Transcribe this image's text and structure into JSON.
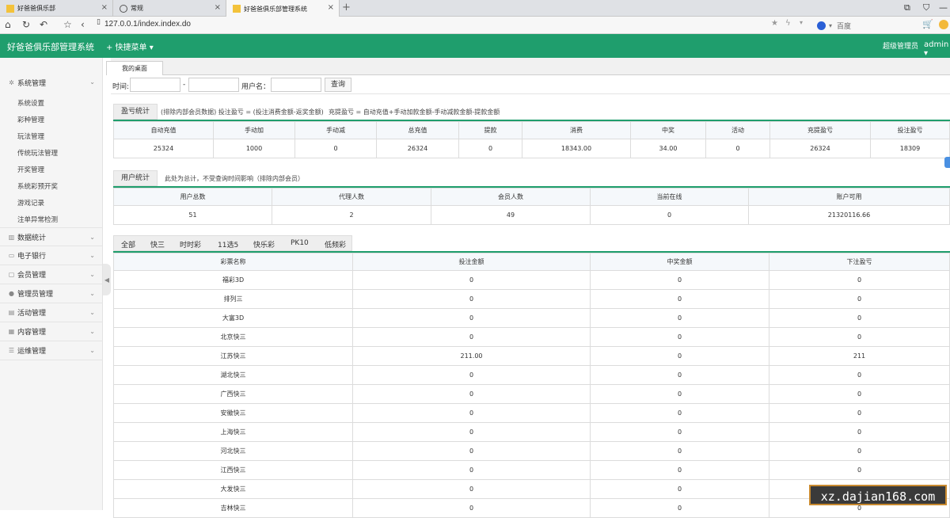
{
  "browser": {
    "tabs": [
      {
        "title": "好爸爸俱乐部"
      },
      {
        "title": "常规"
      },
      {
        "title": "好爸爸俱乐部管理系统"
      }
    ],
    "url": "127.0.0.1/index.index.do",
    "search_placeholder": "百度"
  },
  "header": {
    "title": "好爸爸俱乐部管理系统",
    "quick_menu": "+ 快捷菜单",
    "role": "超级管理员",
    "user": "admin"
  },
  "sidebar": {
    "groups": [
      {
        "label": "系统管理",
        "items": [
          "系统设置",
          "彩种管理",
          "玩法管理",
          "传统玩法管理",
          "开奖管理",
          "系统彩预开奖",
          "游戏记录",
          "注单异常检测"
        ]
      },
      {
        "label": "数据统计"
      },
      {
        "label": "电子银行"
      },
      {
        "label": "会员管理"
      },
      {
        "label": "管理员管理"
      },
      {
        "label": "活动管理"
      },
      {
        "label": "内容管理"
      },
      {
        "label": "运维管理"
      }
    ]
  },
  "page_tab": "我的桌面",
  "filter": {
    "time_label": "时间:",
    "dash": "-",
    "username_label": "用户名：",
    "query": "查询"
  },
  "profit": {
    "button": "盈亏统计",
    "note1": "(排除内部会员数据)  投注盈亏 = (投注消费金额-返奖金额)",
    "note2": "充提盈亏 = 自动充值+手动加款金额-手动减款金额-提款金额",
    "headers": [
      "自动充值",
      "手动加",
      "手动减",
      "总充值",
      "提款",
      "消费",
      "中奖",
      "活动",
      "充提盈亏",
      "投注盈亏"
    ],
    "values": [
      "25324",
      "1000",
      "0",
      "26324",
      "0",
      "18343.00",
      "34.00",
      "0",
      "26324",
      "18309"
    ]
  },
  "users": {
    "button": "用户统计",
    "note": "此处为总计，不受查询时间影响（排除内部会员）",
    "headers": [
      "用户总数",
      "代理人数",
      "会员人数",
      "当前在线",
      "账户可用"
    ],
    "values": [
      "51",
      "2",
      "49",
      "0",
      "21320116.66"
    ]
  },
  "lottery_tabs": [
    "全部",
    "快三",
    "时时彩",
    "11选5",
    "快乐彩",
    "PK10",
    "低频彩"
  ],
  "lottery_table": {
    "headers": [
      "彩票名称",
      "投注金额",
      "中奖金额",
      "下注盈亏"
    ],
    "rows": [
      [
        "福彩3D",
        "0",
        "0",
        "0"
      ],
      [
        "排列三",
        "0",
        "0",
        "0"
      ],
      [
        "大富3D",
        "0",
        "0",
        "0"
      ],
      [
        "北京快三",
        "0",
        "0",
        "0"
      ],
      [
        "江苏快三",
        "211.00",
        "0",
        "211"
      ],
      [
        "湖北快三",
        "0",
        "0",
        "0"
      ],
      [
        "广西快三",
        "0",
        "0",
        "0"
      ],
      [
        "安徽快三",
        "0",
        "0",
        "0"
      ],
      [
        "上海快三",
        "0",
        "0",
        "0"
      ],
      [
        "河北快三",
        "0",
        "0",
        "0"
      ],
      [
        "江西快三",
        "0",
        "0",
        "0"
      ],
      [
        "大发快三",
        "0",
        "0",
        "0"
      ],
      [
        "吉林快三",
        "0",
        "0",
        "0"
      ]
    ]
  },
  "watermark": "xz.dajian168.com"
}
